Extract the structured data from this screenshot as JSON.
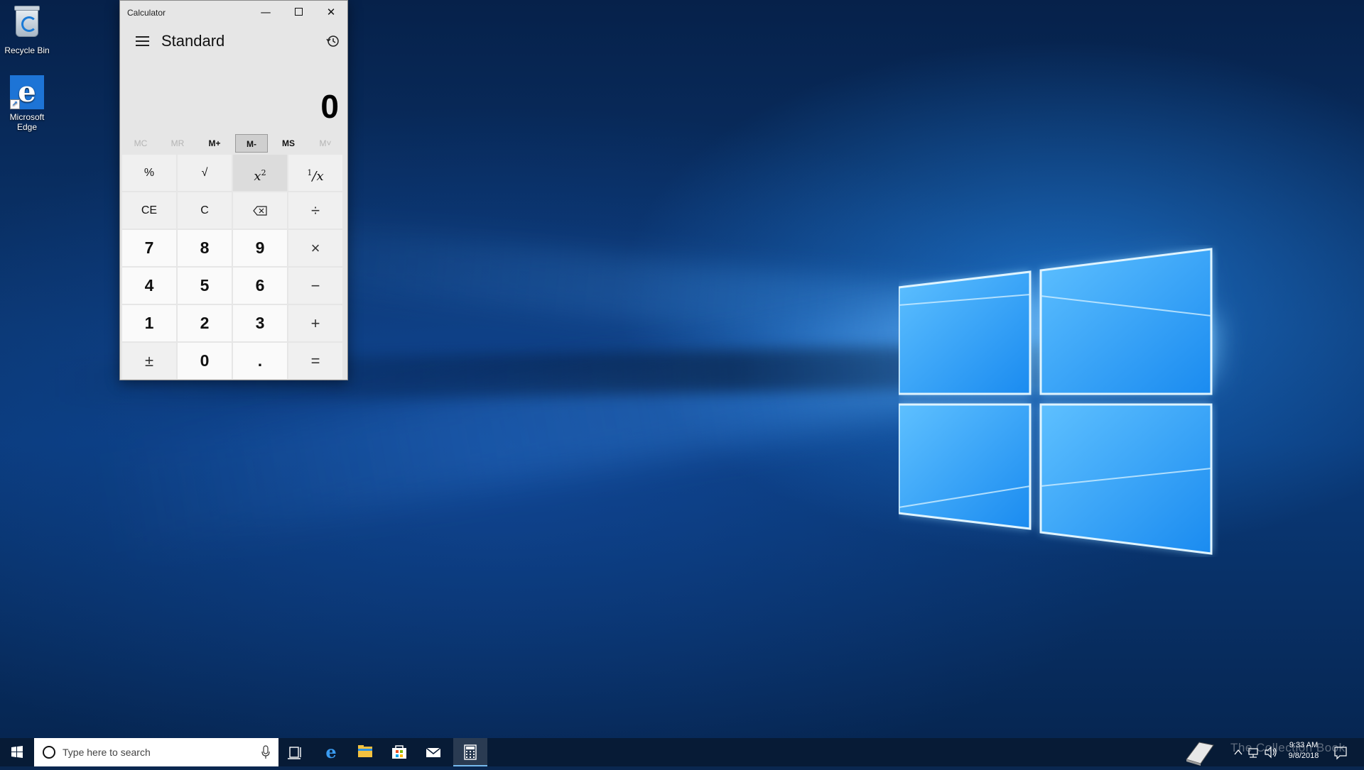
{
  "desktop": {
    "icons": [
      {
        "label": "Recycle Bin",
        "icon": "recycle-bin-icon"
      },
      {
        "label": "Microsoft Edge",
        "icon": "edge-icon"
      }
    ]
  },
  "calculator": {
    "window_title": "Calculator",
    "mode": "Standard",
    "display_value": "0",
    "memory_buttons": [
      {
        "label": "MC",
        "enabled": false
      },
      {
        "label": "MR",
        "enabled": false
      },
      {
        "label": "M+",
        "enabled": true
      },
      {
        "label": "M-",
        "enabled": true,
        "active": true
      },
      {
        "label": "MS",
        "enabled": true
      },
      {
        "label": "M˅",
        "enabled": false
      }
    ],
    "keys": {
      "percent": "%",
      "sqrt": "√",
      "square": "x²",
      "reciprocal": "¹/x",
      "ce": "CE",
      "c": "C",
      "backspace": "⌫",
      "divide": "÷",
      "seven": "7",
      "eight": "8",
      "nine": "9",
      "multiply": "×",
      "four": "4",
      "five": "5",
      "six": "6",
      "minus": "−",
      "one": "1",
      "two": "2",
      "three": "3",
      "plus": "+",
      "negate": "±",
      "zero": "0",
      "decimal": ".",
      "equals": "="
    }
  },
  "taskbar": {
    "search_placeholder": "Type here to search",
    "pinned": [
      "task-view-icon",
      "edge-icon",
      "file-explorer-icon",
      "store-icon",
      "mail-icon",
      "calculator-icon"
    ],
    "clock_time": "9:33 AM",
    "clock_date": "9/8/2018",
    "watermark": "The Collection Book"
  },
  "colors": {
    "accent": "#0078d7",
    "calculator_bg": "#e6e6e6",
    "taskbar_bg": "#081a34"
  }
}
